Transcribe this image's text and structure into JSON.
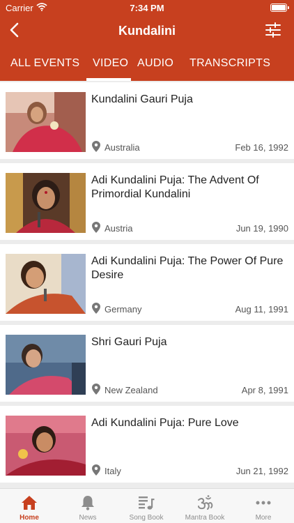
{
  "status_bar": {
    "carrier": "Carrier",
    "time": "7:34 PM"
  },
  "nav": {
    "title": "Kundalini"
  },
  "tabs": [
    {
      "label": "ALL EVENTS"
    },
    {
      "label": "VIDEO"
    },
    {
      "label": "AUDIO"
    },
    {
      "label": "TRANSCRIPTS"
    }
  ],
  "active_tab": "VIDEO",
  "items": [
    {
      "title": "Kundalini Gauri Puja",
      "location": "Australia",
      "date": "Feb 16, 1992"
    },
    {
      "title": "Adi Kundalini Puja: The Advent Of Primordial Kundalini",
      "location": "Austria",
      "date": "Jun 19, 1990"
    },
    {
      "title": "Adi Kundalini Puja: The Power Of Pure Desire",
      "location": "Germany",
      "date": "Aug 11, 1991"
    },
    {
      "title": "Shri Gauri Puja",
      "location": "New Zealand",
      "date": "Apr 8, 1991"
    },
    {
      "title": "Adi Kundalini Puja: Pure Love",
      "location": "Italy",
      "date": "Jun 21, 1992"
    }
  ],
  "tabbar": [
    {
      "label": "Home",
      "icon": "home-icon"
    },
    {
      "label": "News",
      "icon": "bell-icon"
    },
    {
      "label": "Song Book",
      "icon": "music-list-icon"
    },
    {
      "label": "Mantra Book",
      "icon": "om-icon"
    },
    {
      "label": "More",
      "icon": "more-dots-icon"
    }
  ],
  "colors": {
    "accent": "#c7401f",
    "inactive": "#8d8d8d"
  }
}
